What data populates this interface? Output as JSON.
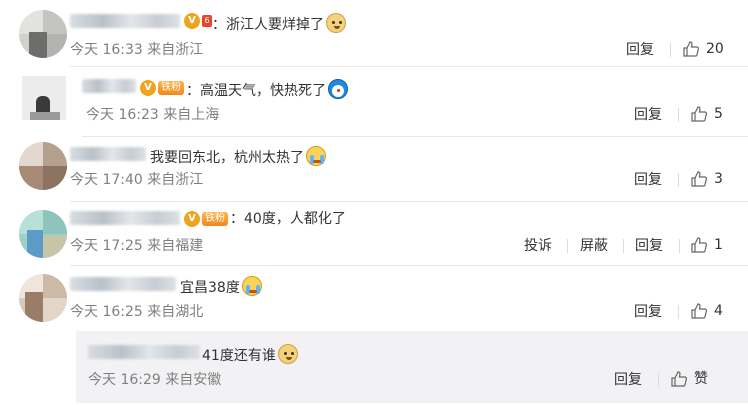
{
  "comments": [
    {
      "text": "：浙江人要烊掉了",
      "emoji": "doge-icon",
      "time": "今天 16:33",
      "location": "来自浙江",
      "reply": "回复",
      "likes": "20"
    },
    {
      "text": "：高温天气，快热死了",
      "emoji": "doraemon-icon",
      "fan_badge": "铁粉",
      "time": "今天 16:23",
      "location": "来自上海",
      "reply": "回复",
      "likes": "5"
    },
    {
      "text": "我要回东北，杭州太热了",
      "emoji": "crying-icon",
      "time": "今天 17:40",
      "location": "来自浙江",
      "reply": "回复",
      "likes": "3"
    },
    {
      "text": "：40度，人都化了",
      "fan_badge": "铁粉",
      "time": "今天 17:25",
      "location": "来自福建",
      "report": "投诉",
      "block": "屏蔽",
      "reply": "回复",
      "likes": "1"
    },
    {
      "text": "宜昌38度",
      "emoji": "crying-icon",
      "time": "今天 16:25",
      "location": "来自湖北",
      "reply": "回复",
      "likes": "4"
    }
  ],
  "sub_reply": {
    "text": "41度还有谁",
    "emoji": "doge-icon",
    "time": "今天 16:29",
    "location": "来自安徽",
    "reply": "回复",
    "like": "赞"
  },
  "colors": {
    "text": "#333333",
    "meta": "#808080",
    "reply_bg": "#f2f2f5",
    "divider": "#e8e8e8",
    "vip": "#f0a41d"
  }
}
